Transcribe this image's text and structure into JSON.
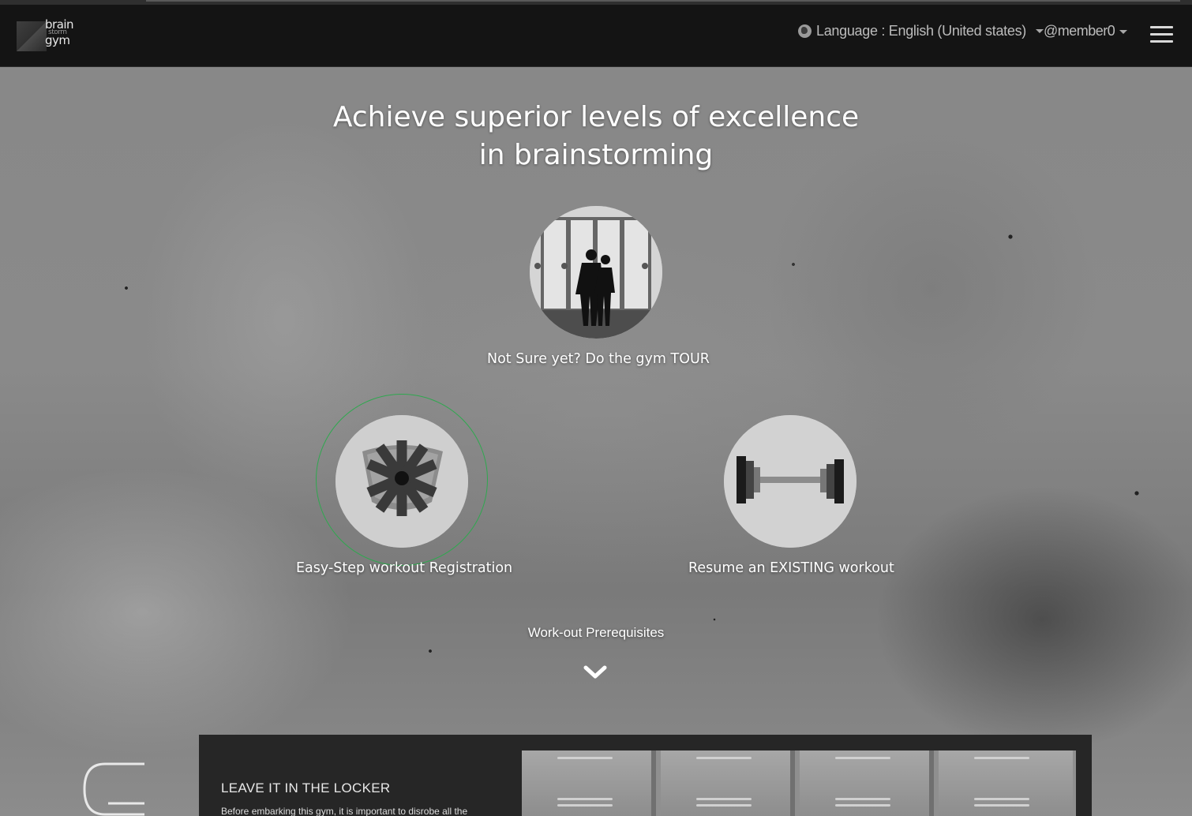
{
  "app": {
    "logo_lines": [
      "brain",
      "storm",
      "gym"
    ]
  },
  "navbar": {
    "language_label": "Language : English (United states)",
    "user_label": "@member0"
  },
  "hero": {
    "headline_line1": "Achieve superior levels of excellence",
    "headline_line2": "in brainstorming",
    "tour_label": "Not Sure yet? Do the gym TOUR",
    "registration_label": "Easy-Step workout Registration",
    "resume_label": "Resume an EXISTING workout",
    "prereq_label": "Work-out Prerequisites"
  },
  "panel": {
    "title": "LEAVE IT IN THE LOCKER",
    "text": "Before embarking this gym, it is important to disrobe all the"
  },
  "colors": {
    "navbar_bg": "#141414",
    "focus_ring": "#2fa84f",
    "circle_bg": "#cfcfcf"
  }
}
